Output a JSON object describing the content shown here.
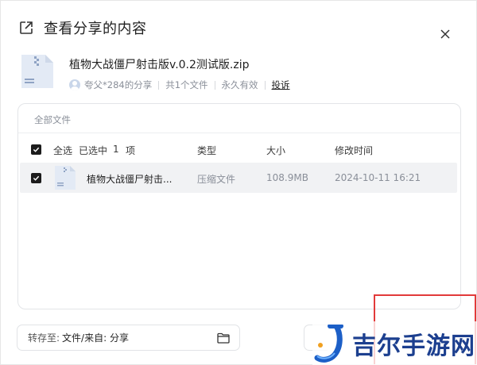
{
  "dialog": {
    "title": "查看分享的内容"
  },
  "file": {
    "name": "植物大战僵尸射击版v.0.2测试版.zip",
    "sharer": "夸父*284的分享",
    "count": "共1个文件",
    "validity": "永久有效",
    "report": "投诉"
  },
  "panel": {
    "title": "全部文件",
    "select_all": "全选",
    "selected": "已选中",
    "selected_count": "1",
    "selected_unit": "项",
    "columns": [
      "类型",
      "大小",
      "修改时间"
    ]
  },
  "rows": [
    {
      "name": "植物大战僵尸射击...",
      "type": "压缩文件",
      "size": "108.9MB",
      "modified": "2024-10-11 16:21",
      "checked": true
    }
  ],
  "footer": {
    "save_label": "转存至:",
    "save_path": "文件/来自: 分享"
  },
  "watermark": {
    "text": "吉尔手游网"
  },
  "colors": {
    "accent_dark": "#1c1c1c",
    "highlight_frame": "#e23a3a",
    "watermark_blue": "#1c3f8f"
  }
}
